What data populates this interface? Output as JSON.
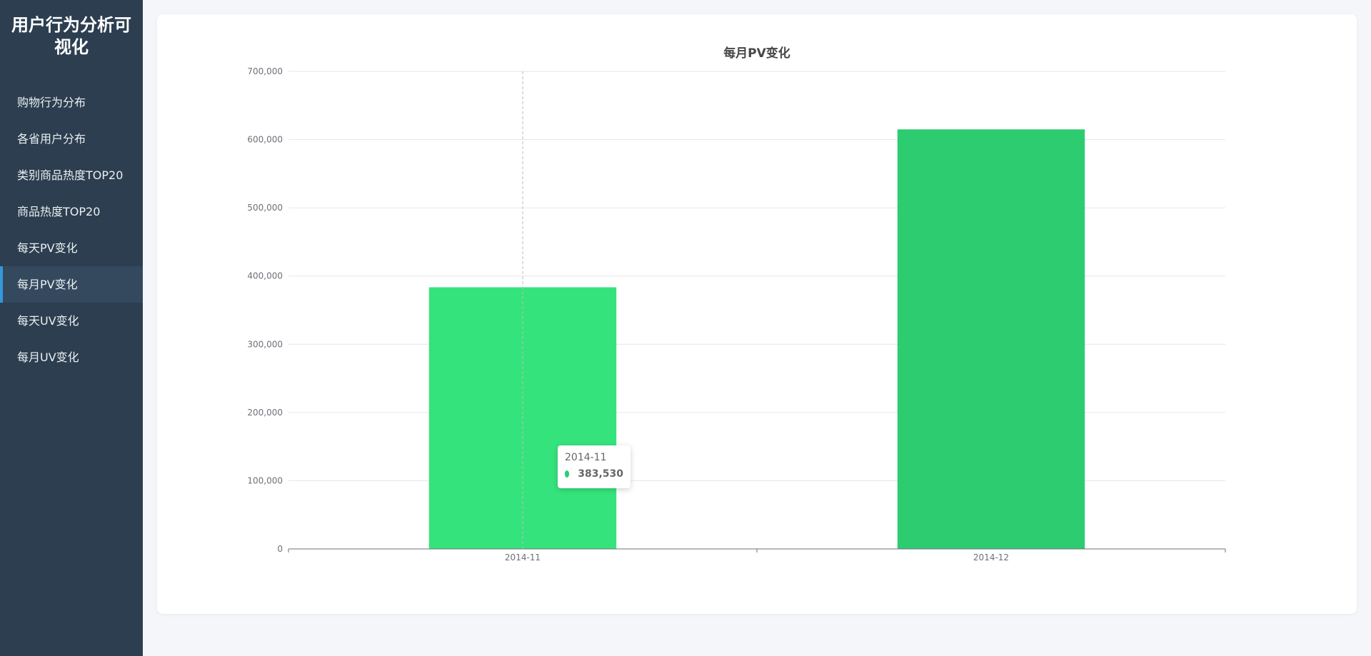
{
  "sidebar": {
    "title": "用户行为分析可视化",
    "items": [
      {
        "label": "购物行为分布",
        "active": false
      },
      {
        "label": "各省用户分布",
        "active": false
      },
      {
        "label": "类别商品热度TOP20",
        "active": false
      },
      {
        "label": "商品热度TOP20",
        "active": false
      },
      {
        "label": "每天PV变化",
        "active": false
      },
      {
        "label": "每月PV变化",
        "active": true
      },
      {
        "label": "每天UV变化",
        "active": false
      },
      {
        "label": "每月UV变化",
        "active": false
      }
    ]
  },
  "tooltip": {
    "category": "2014-11",
    "value_text": "383,530"
  },
  "colors": {
    "bar_hover": "#35e37c",
    "bar": "#2ecc71",
    "sidebar_bg": "#2c3e50",
    "active_bg": "#34495e",
    "active_border": "#3498db"
  },
  "chart_data": {
    "type": "bar",
    "title": "每月PV变化",
    "categories": [
      "2014-11",
      "2014-12"
    ],
    "values": [
      383530,
      615000
    ],
    "ylim": [
      0,
      700000
    ],
    "yticks": [
      0,
      100000,
      200000,
      300000,
      400000,
      500000,
      600000,
      700000
    ],
    "ytick_labels": [
      "0",
      "100,000",
      "200,000",
      "300,000",
      "400,000",
      "500,000",
      "600,000",
      "700,000"
    ],
    "grid": true,
    "legend": "none",
    "highlighted_index": 0
  }
}
